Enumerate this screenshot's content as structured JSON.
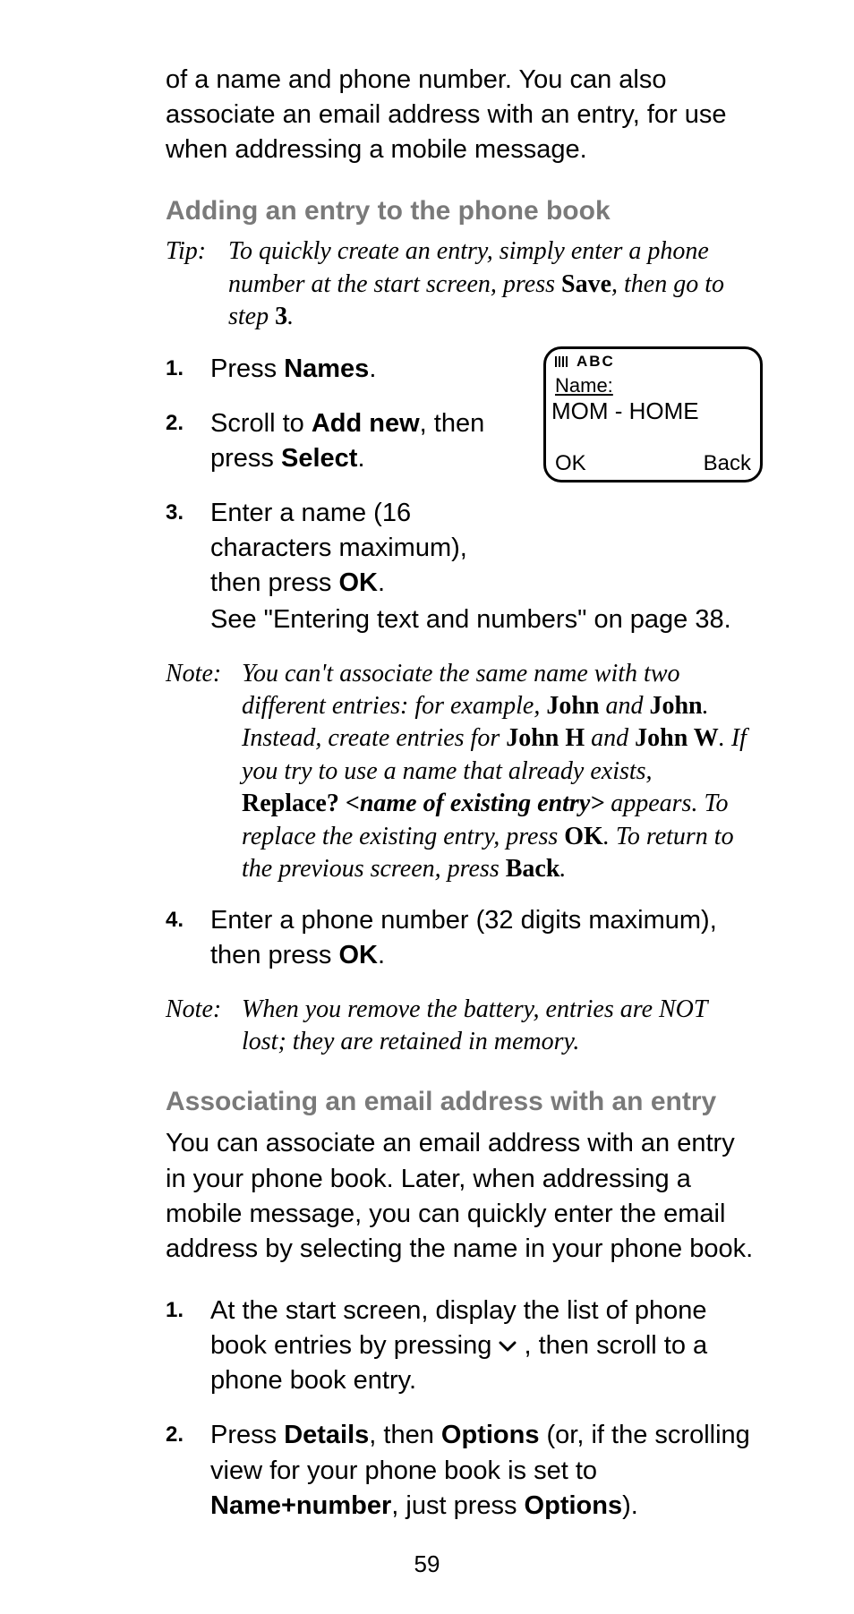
{
  "page_number": "59",
  "content": {
    "lead": "of a name and phone number. You can also associate an email address with an entry, for use when addressing a mobile message.",
    "heading_add": "Adding an entry to the phone book",
    "tip_label": "Tip:",
    "tip_pre": "To quickly create an entry, simply enter a phone number at the start screen, press ",
    "tip_bold": "Save",
    "tip_post_1": ", then go to step ",
    "tip_step_ref": "3",
    "tip_post_2": ".",
    "steps_a": {
      "n1": "1.",
      "s1_pre": "Press ",
      "s1_b": "Names",
      "s1_post": ".",
      "n2": "2.",
      "s2_pre": "Scroll to ",
      "s2_b1": "Add new",
      "s2_mid": ", then press ",
      "s2_b2": "Select",
      "s2_post": ".",
      "n3": "3.",
      "s3_pre": "Enter a name (16 characters maximum), then press ",
      "s3_b": "OK",
      "s3_post": ".",
      "s3_sub": "See \"Entering text and numbers\" on page 38.",
      "n4": "4.",
      "s4_pre": "Enter a phone number (32 digits maximum), then press ",
      "s4_b": "OK",
      "s4_post": "."
    },
    "note1_label": "Note:",
    "note1": {
      "t1": "You can't associate the same name with two different entries: for example, ",
      "b1": "John",
      "t2": " and ",
      "b2": "John",
      "t3": ". Instead, create entries for ",
      "b3": "John H",
      "t4": " and ",
      "b4": "John W",
      "t5": ". If you try to use a name that already exists, ",
      "b5": "Replace? ",
      "bi5": "<name of existing entry>",
      "t6": " appears. To replace the existing entry, press ",
      "b6": "OK",
      "t7": ". To return to the previous screen, press ",
      "b7": "Back",
      "t8": "."
    },
    "note2_label": "Note:",
    "note2_text": "When you remove the battery, entries are NOT lost; they are retained in memory.",
    "heading_email": "Associating an email address with an entry",
    "email_intro": "You can associate an email address with an entry in your phone book. Later, when addressing a mobile message, you can quickly enter the email address by selecting the name in your phone book.",
    "steps_b": {
      "n1": "1.",
      "s1_pre": "At the start screen, display the list of phone book entries by pressing ",
      "s1_post": " , then scroll to a phone book entry.",
      "n2": "2.",
      "s2_pre": "Press ",
      "s2_b1": "Details",
      "s2_mid1": ", then ",
      "s2_b2": "Options",
      "s2_mid2": " (or, if the scrolling view for your phone book is set to ",
      "s2_b3": "Name+number",
      "s2_mid3": ", just press ",
      "s2_b4": "Options",
      "s2_post": ")."
    }
  },
  "phone_screen": {
    "status": "ABC",
    "name_label": "Name:",
    "value": "MOM - HOME",
    "softkey_left": "OK",
    "softkey_right": "Back"
  }
}
